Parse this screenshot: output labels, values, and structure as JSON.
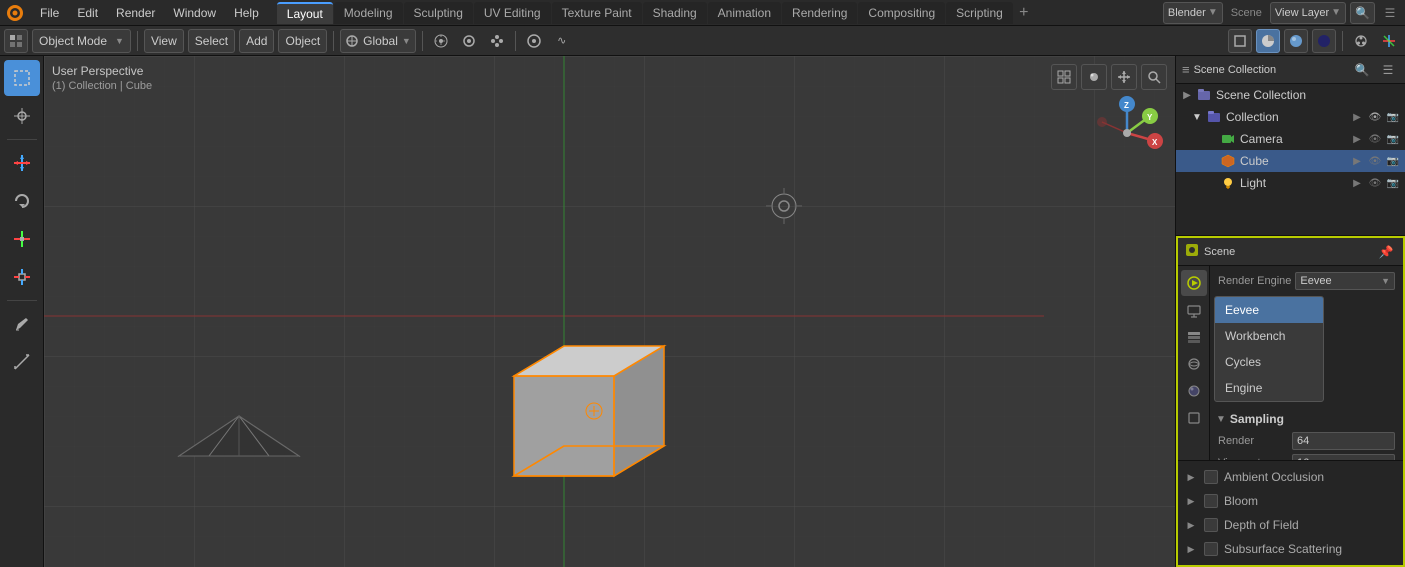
{
  "app": {
    "title": "Blender"
  },
  "top_menu": {
    "items": [
      "Blender",
      "File",
      "Edit",
      "Render",
      "Window",
      "Help"
    ]
  },
  "workspace_tabs": {
    "tabs": [
      "Layout",
      "Modeling",
      "Sculpting",
      "UV Editing",
      "Texture Paint",
      "Shading",
      "Animation",
      "Rendering",
      "Compositing",
      "Scripting"
    ],
    "active": "Layout"
  },
  "toolbar": {
    "mode": "Object Mode",
    "view_label": "View",
    "select_label": "Select",
    "add_label": "Add",
    "object_label": "Object",
    "global_label": "Global",
    "snap_icon": "⊞",
    "proportional_icon": "◎"
  },
  "viewport": {
    "perspective_label": "User Perspective",
    "collection_label": "(1) Collection | Cube",
    "gizmo_axes": [
      "X",
      "Y",
      "Z"
    ]
  },
  "left_tools": {
    "tools": [
      {
        "name": "select-box-tool",
        "icon": "⬚",
        "active": true
      },
      {
        "name": "cursor-tool",
        "icon": "⊕"
      },
      {
        "name": "move-tool",
        "icon": "✛"
      },
      {
        "name": "rotate-tool",
        "icon": "↺"
      },
      {
        "name": "scale-tool",
        "icon": "⤡"
      },
      {
        "name": "transform-tool",
        "icon": "⊞"
      },
      {
        "name": "annotate-tool",
        "icon": "✏"
      },
      {
        "name": "measure-tool",
        "icon": "📐"
      }
    ]
  },
  "outliner": {
    "title": "Scene Collection",
    "items": [
      {
        "label": "Collection",
        "icon": "📁",
        "color": "#aaaaff",
        "indent": 0,
        "expanded": true,
        "children": [
          {
            "label": "Camera",
            "icon": "📷",
            "color": "#aaffaa",
            "indent": 1
          },
          {
            "label": "Cube",
            "icon": "⬡",
            "color": "#ffaa44",
            "indent": 1,
            "selected": true
          },
          {
            "label": "Light",
            "icon": "☀",
            "color": "#ffff88",
            "indent": 1
          }
        ]
      }
    ]
  },
  "scene_render_panel": {
    "title": "Scene",
    "render_engine_label": "Render Engine",
    "render_engine_value": "Eevee",
    "sampling_section": "Sampling",
    "render_label": "Render",
    "viewport_label": "Viewport",
    "dropdown_options": [
      "Eevee",
      "Workbench",
      "Cycles",
      "Engine"
    ],
    "dropdown_selected": "Eevee"
  },
  "properties_bottom": {
    "ambient_occlusion_label": "Ambient Occlusion",
    "bloom_label": "Bloom",
    "depth_of_field_label": "Depth of Field",
    "subsurface_scattering_label": "Subsurface Scattering"
  },
  "view_layer": {
    "title": "View Layer"
  }
}
